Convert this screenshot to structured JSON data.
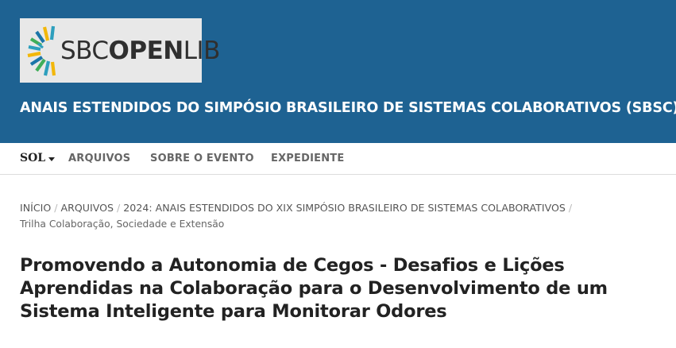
{
  "header": {
    "logo": {
      "text_prefix": "SBC",
      "text_bold": "OPEN",
      "text_suffix": "LIB"
    },
    "site_title": "ANAIS ESTENDIDOS DO SIMPÓSIO BRASILEIRO DE SISTEMAS COLABORATIVOS (SBSC)",
    "background_color": "#1e6292"
  },
  "nav": {
    "language": "SOL",
    "items": [
      {
        "label": "ARQUIVOS"
      },
      {
        "label": "SOBRE O EVENTO"
      },
      {
        "label": "EXPEDIENTE"
      }
    ]
  },
  "breadcrumb": {
    "items": [
      {
        "label": "INÍCIO"
      },
      {
        "label": "ARQUIVOS"
      },
      {
        "label": "2024: ANAIS ESTENDIDOS DO XIX SIMPÓSIO BRASILEIRO DE SISTEMAS COLABORATIVOS"
      }
    ],
    "current": "Trilha Colaboração, Sociedade e Extensão"
  },
  "article": {
    "title": "Promovendo a Autonomia de Cegos - Desafios e Lições Aprendidas na Colaboração para o Desenvolvimento de um Sistema Inteligente para Monitorar Odores"
  }
}
